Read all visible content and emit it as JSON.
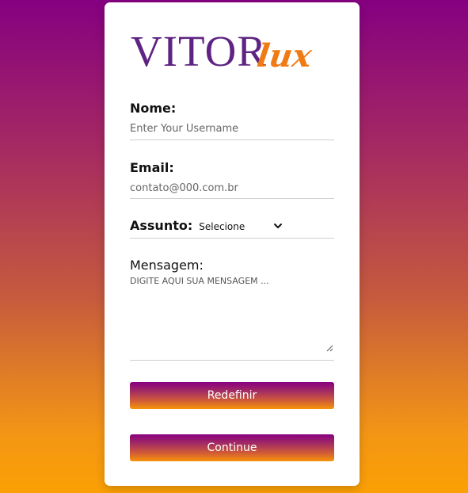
{
  "logo": {
    "main": "VITOR",
    "script": "lux"
  },
  "form": {
    "name": {
      "label": "Nome:",
      "placeholder": "Enter Your Username"
    },
    "email": {
      "label": "Email:",
      "placeholder": "contato@000.com.br"
    },
    "subject": {
      "label": "Assunto:",
      "selected": "Selecione"
    },
    "message": {
      "label": "Mensagem:",
      "placeholder": "DIGITE AQUI SUA MENSAGEM ..."
    }
  },
  "buttons": {
    "reset_label": "Redefinir",
    "continue_label": "Continue"
  },
  "colors": {
    "brand_purple": "#5f2483",
    "brand_orange": "#f07b14",
    "gradient_top": "#850081",
    "gradient_bottom": "#fba004"
  },
  "icons": {
    "select_arrow": "chevron-down-icon",
    "textarea_resize": "resize-grip-icon"
  }
}
